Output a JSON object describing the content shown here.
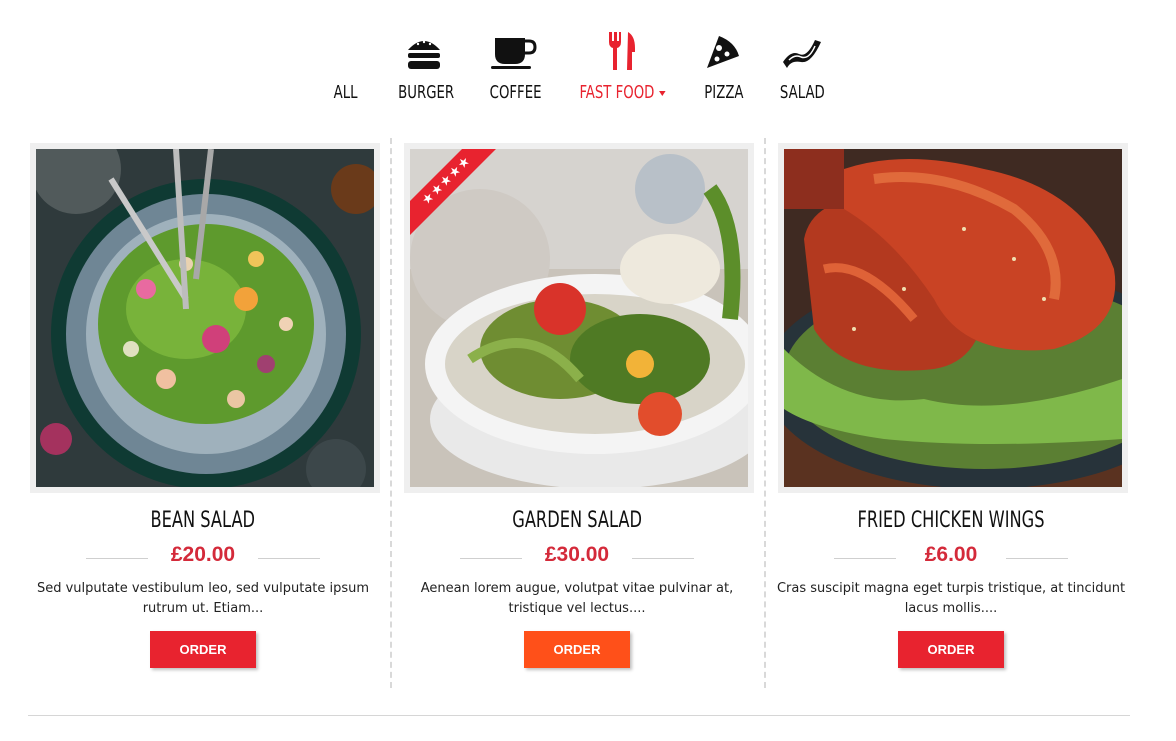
{
  "tabs": [
    {
      "label": "ALL",
      "icon": "none",
      "active": false
    },
    {
      "label": "BURGER",
      "icon": "burger-icon",
      "active": false
    },
    {
      "label": "COFFEE",
      "icon": "coffee-cup-icon",
      "active": false
    },
    {
      "label": "FAST FOOD",
      "icon": "fork-knife-icon",
      "active": true,
      "has_dropdown": true
    },
    {
      "label": "PIZZA",
      "icon": "pizza-slice-icon",
      "active": false
    },
    {
      "label": "SALAD",
      "icon": "bacon-icon",
      "active": false
    }
  ],
  "products": [
    {
      "name": "BEAN SALAD",
      "price": "£20.00",
      "description": "Sed vulputate vestibulum leo, sed vulputate ipsum rutrum ut. Etiam...",
      "button": "ORDER",
      "featured": false,
      "image": "bowl-of-bean-salad-photo"
    },
    {
      "name": "GARDEN SALAD",
      "price": "£30.00",
      "description": "Aenean lorem augue, volutpat vitae pulvinar at, tristique vel lectus....",
      "button": "ORDER",
      "featured": true,
      "badge": "★★★★★",
      "image": "garden-salad-bowl-photo"
    },
    {
      "name": "FRIED CHICKEN WINGS",
      "price": "£6.00",
      "description": "Cras suscipit magna eget turpis tristique, at tincidunt lacus mollis....",
      "button": "ORDER",
      "featured": false,
      "image": "chicken-wings-photo"
    }
  ],
  "colors": {
    "accent": "#e8232f",
    "order_hover": "#ff5019",
    "price": "#d42a3a"
  }
}
